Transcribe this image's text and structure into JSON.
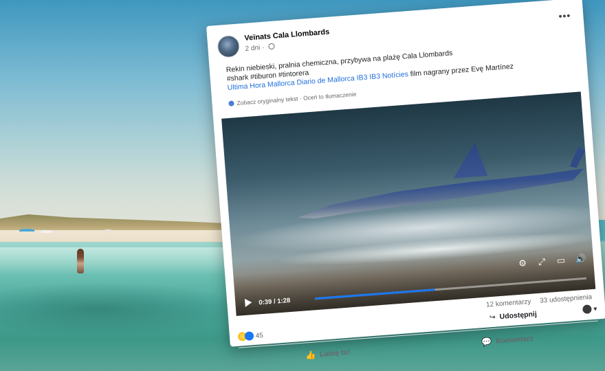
{
  "post": {
    "page_name": "Veïnats Cala Llombards",
    "time": "2 dni",
    "text_line1": "Rekin niebieski, pralnia chemiczna, przybywa na plażę Cala Llombards",
    "text_line2_suffix": " film nagrany przez Evę Martínez",
    "hashtags": "#shark #tiburon #tintorera",
    "links": "Ultima Hora Mallorca Diario de Mallorca IB3 IB3 Notícies",
    "translate": "Zobacz oryginalny tekst · Oceń to tłumaczenie",
    "more": "•••"
  },
  "video": {
    "time": "0:39 / 1:28",
    "progress": 0.443
  },
  "stats": {
    "reactions_count": "45",
    "comments": "12 komentarzy",
    "shares": "33 udostępnienia"
  },
  "actions": {
    "share": "Udostępnij",
    "like": "Lubię to!",
    "comment": "Komentarz"
  },
  "icons": {
    "globe": "globe-icon",
    "settings": "⚙",
    "fullscreen": "⤢",
    "pip": "▭",
    "volume": "🔊",
    "play": "play-icon"
  },
  "colors": {
    "link": "#216fdb",
    "progress": "#1877f2"
  }
}
